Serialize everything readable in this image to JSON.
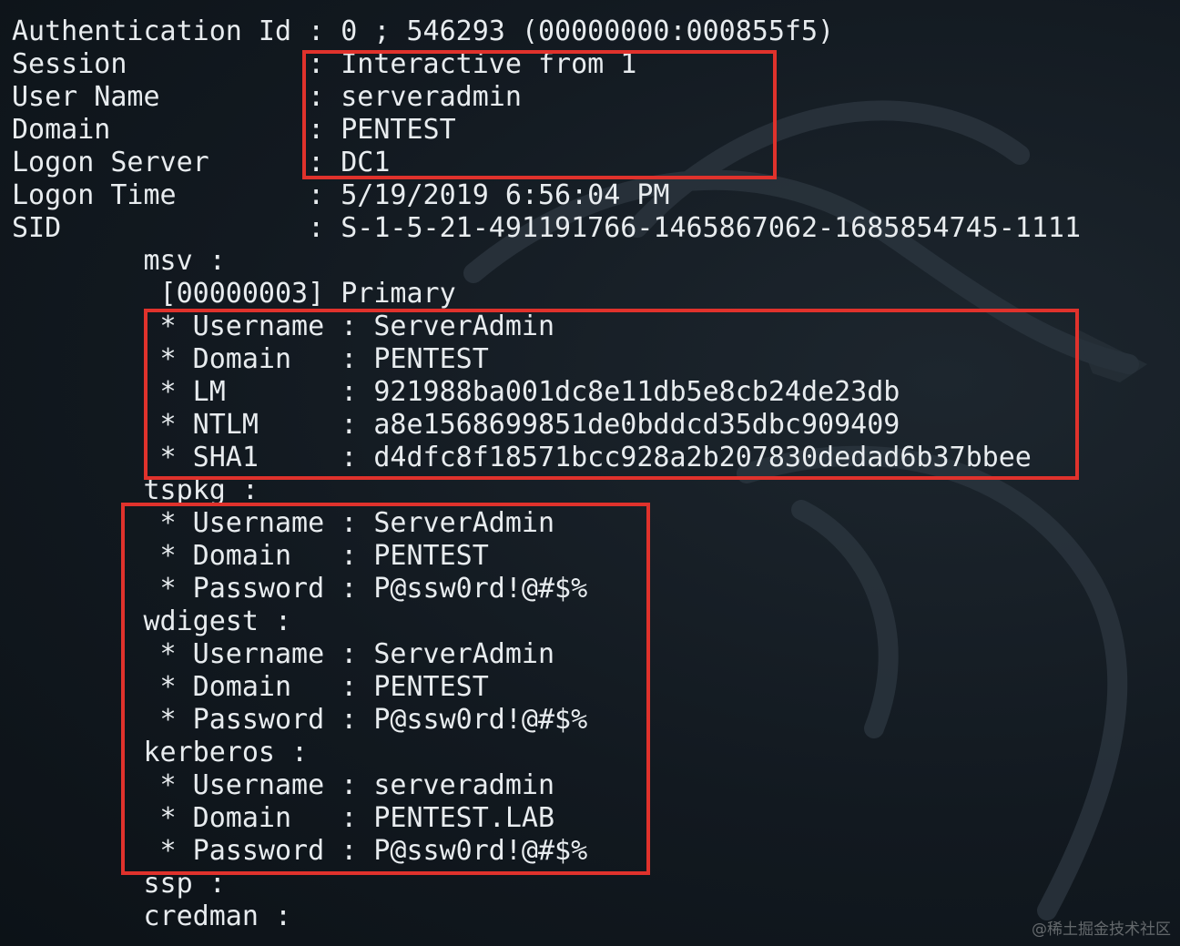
{
  "lines": [
    "Authentication Id : 0 ; 546293 (00000000:000855f5)",
    "Session           : Interactive from 1",
    "User Name         : serveradmin",
    "Domain            : PENTEST",
    "Logon Server      : DC1",
    "Logon Time        : 5/19/2019 6:56:04 PM",
    "SID               : S-1-5-21-491191766-1465867062-1685854745-1111",
    "        msv :",
    "         [00000003] Primary",
    "         * Username : ServerAdmin",
    "         * Domain   : PENTEST",
    "         * LM       : 921988ba001dc8e11db5e8cb24de23db",
    "         * NTLM     : a8e1568699851de0bddcd35dbc909409",
    "         * SHA1     : d4dfc8f18571bcc928a2b207830dedad6b37bbee",
    "        tspkg :",
    "         * Username : ServerAdmin",
    "         * Domain   : PENTEST",
    "         * Password : P@ssw0rd!@#$%",
    "        wdigest :",
    "         * Username : ServerAdmin",
    "         * Domain   : PENTEST",
    "         * Password : P@ssw0rd!@#$%",
    "        kerberos :",
    "         * Username : serveradmin",
    "         * Domain   : PENTEST.LAB",
    "         * Password : P@ssw0rd!@#$%",
    "        ssp :",
    "        credman :"
  ],
  "watermark": "@稀土掘金技术社区",
  "colors": {
    "background": "#121920",
    "text": "#e8ecef",
    "highlight": "#e0322c"
  }
}
